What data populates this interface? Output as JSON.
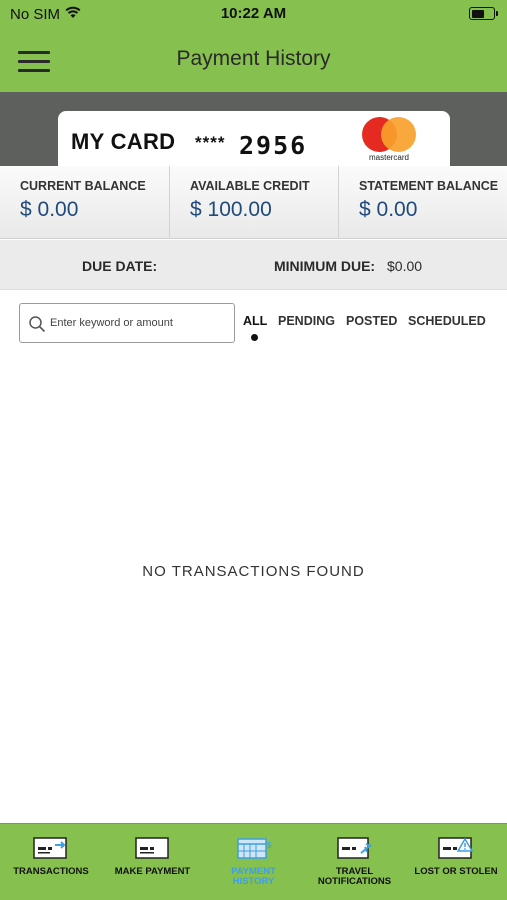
{
  "status_bar": {
    "carrier": "No SIM",
    "time": "10:22 AM",
    "battery_level": 0.6
  },
  "header": {
    "title": "Payment History",
    "menu_icon": "hamburger-menu-icon"
  },
  "card": {
    "name": "MY CARD",
    "mask": "****",
    "last4": "2956",
    "brand": "mastercard",
    "brand_colors": {
      "red": "#e52b21",
      "orange": "#f8a12d"
    }
  },
  "balances": [
    {
      "label": "CURRENT BALANCE",
      "value": "$ 0.00"
    },
    {
      "label": "AVAILABLE CREDIT",
      "value": "$ 100.00"
    },
    {
      "label": "STATEMENT BALANCE",
      "value": "$ 0.00"
    }
  ],
  "due": {
    "due_date_label": "DUE DATE:",
    "due_date_value": "",
    "minimum_due_label": "MINIMUM DUE:",
    "minimum_due_value": "$0.00"
  },
  "search": {
    "placeholder": "Enter keyword or amount",
    "value": "",
    "icon": "search-icon"
  },
  "filters": {
    "items": [
      "ALL",
      "PENDING",
      "POSTED",
      "SCHEDULED"
    ],
    "selected": "ALL"
  },
  "empty_state": "NO TRANSACTIONS FOUND",
  "tabbar": {
    "items": [
      {
        "label": "TRANSACTIONS",
        "icon": "card-transactions-icon"
      },
      {
        "label": "MAKE PAYMENT",
        "icon": "card-payment-icon"
      },
      {
        "label": "PAYMENT HISTORY",
        "icon": "payment-history-icon"
      },
      {
        "label": "TRAVEL NOTIFICATIONS",
        "icon": "travel-card-icon"
      },
      {
        "label": "LOST OR STOLEN",
        "icon": "card-alert-icon"
      }
    ],
    "active": "PAYMENT HISTORY",
    "active_color": "#3f9fe0"
  },
  "colors": {
    "header_green": "#86c04f",
    "card_band": "#5e605e",
    "balance_value": "#1f4a7a"
  }
}
